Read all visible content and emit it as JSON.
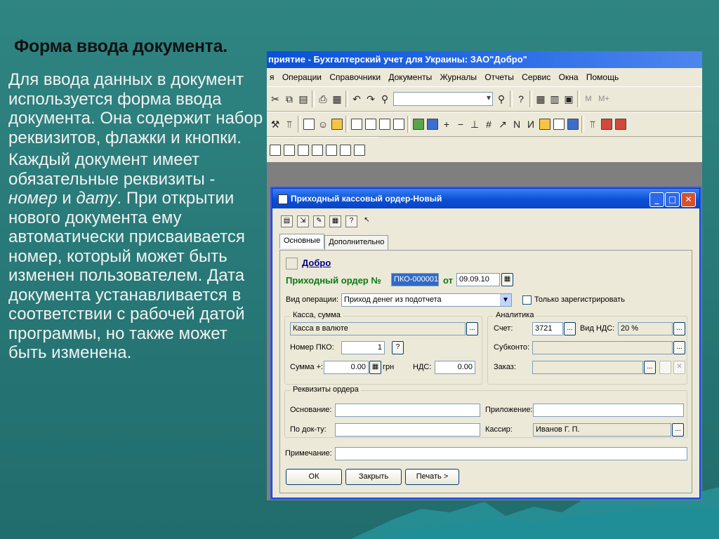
{
  "slide": {
    "title": "Форма ввода документа.",
    "paragraph1": "Для ввода данных в документ используется форма ввода документа. Она содержит набор реквизитов, флажки и кнопки.",
    "paragraph2_part1": "Каждый документ имеет обязательные реквизиты - ",
    "paragraph2_italic1": "номер",
    "paragraph2_part2": " и ",
    "paragraph2_italic2": "дату",
    "paragraph2_part3": ". При открытии нового документа ему автоматически присваивается номер, который может быть изменен пользователем. Дата документа устанавливается в соответствии с рабочей датой программы, но также может быть изменена."
  },
  "app": {
    "title": "приятие - Бухгалтерский учет для Украины: ЗАО\"Добро\"",
    "menu": [
      "я",
      "Операции",
      "Справочники",
      "Документы",
      "Журналы",
      "Отчеты",
      "Сервис",
      "Окна",
      "Помощь"
    ],
    "toolbar_letters": [
      "M",
      "M+"
    ]
  },
  "dialog": {
    "title": "Приходный кассовый ордер-Новый",
    "tabs": [
      "Основные",
      "Дополнительно"
    ],
    "org_name": "Добро",
    "order_label": "Приходный ордер №",
    "order_number": "ПКО-000001",
    "date_label": "от",
    "date_value": "09.09.10",
    "operation_label": "Вид операции:",
    "operation_value": "Приход денег из подотчета",
    "only_registered_label": "Только зарегистрировать",
    "cash_group": {
      "label": "Касса, сумма",
      "cash_value": "Касса в валюте",
      "pko_label": "Номер ПКО:",
      "pko_value": "1",
      "amount_label": "Сумма +:",
      "amount_value": "0.00",
      "currency": "грн",
      "vat_label": "НДС:",
      "vat_value": "0.00"
    },
    "analytics_group": {
      "label": "Аналитика",
      "account_label": "Счет:",
      "account_value": "3721",
      "vat_type_label": "Вид НДС:",
      "vat_type_value": "20 %",
      "subconto_label": "Субконто:",
      "order_label": "Заказ:"
    },
    "details_group": {
      "label": "Реквизиты ордера",
      "basis_label": "Основание:",
      "attachment_label": "Приложение:",
      "by_doc_label": "По док-ту:",
      "cashier_label": "Кассир:",
      "cashier_value": "Иванов Г. П."
    },
    "note_label": "Примечание:",
    "buttons": {
      "ok": "ОК",
      "close": "Закрыть",
      "print": "Печать >"
    },
    "question_button": "?",
    "ellipsis": "...",
    "minimize_glyph": "_",
    "maximize_glyph": "□",
    "close_glyph": "✕",
    "clear_glyph": "✕"
  }
}
